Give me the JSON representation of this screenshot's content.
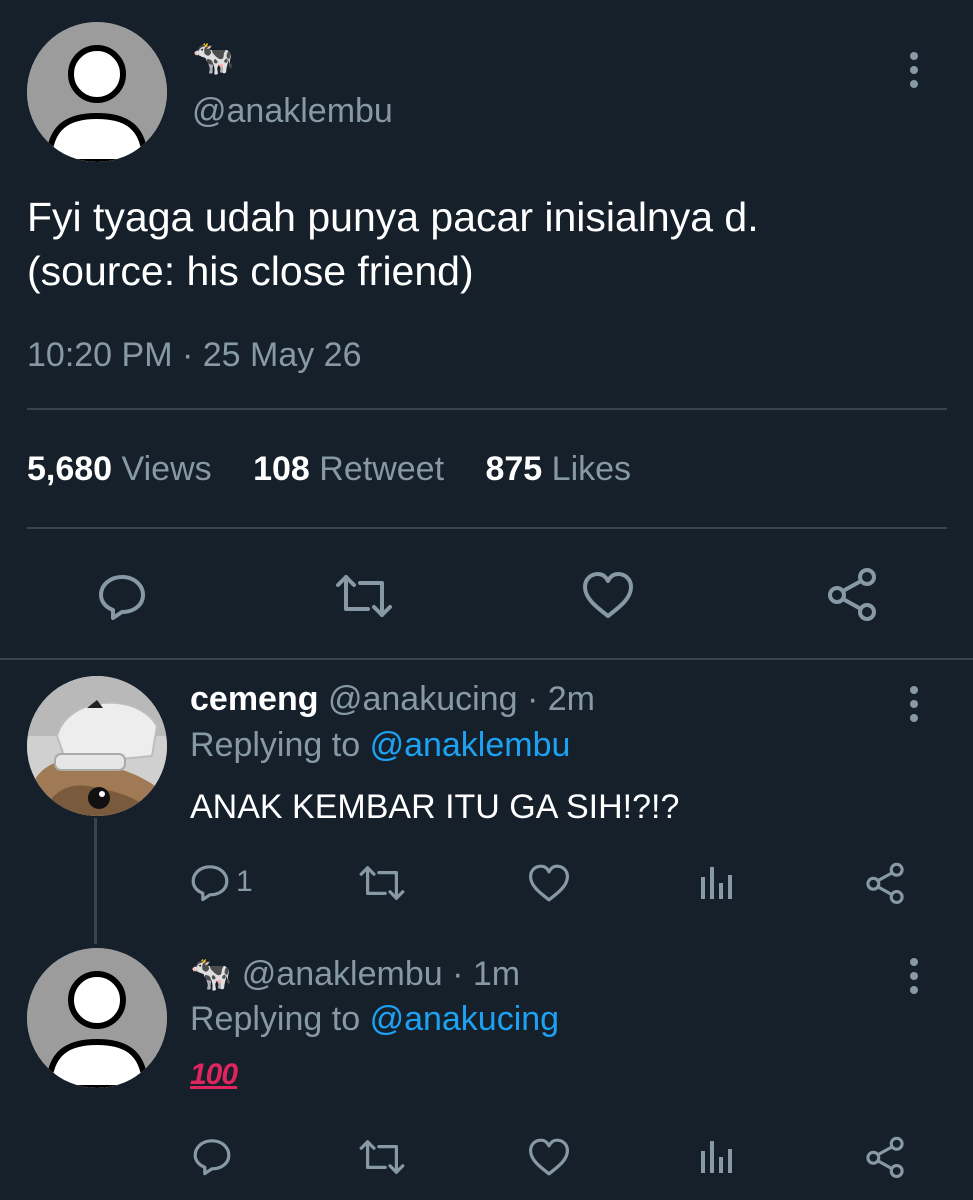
{
  "main_tweet": {
    "user_emoji": "🐄",
    "handle": "@anaklembu",
    "text_line1": "Fyi tyaga udah punya pacar inisialnya d.",
    "text_line2": "(source: his close friend)",
    "timestamp": "10:20 PM · 25 May 26",
    "stats": {
      "views_count": "5,680",
      "views_label": "Views",
      "retweet_count": "108",
      "retweet_label": "Retweet",
      "likes_count": "875",
      "likes_label": "Likes"
    },
    "actions": [
      "reply-icon",
      "retweet-icon",
      "like-icon",
      "share-icon"
    ]
  },
  "replies": [
    {
      "name": "cemeng",
      "handle": "@anakucing",
      "time": "· 2m",
      "replying_prefix": "Replying to",
      "replying_to": "@anaklembu",
      "text": "ANAK KEMBAR ITU GA SIH!?!?",
      "reply_count": "1"
    },
    {
      "user_emoji": "🐄",
      "handle": "@anaklembu",
      "time": "· 1m",
      "replying_prefix": "Replying to",
      "replying_to": "@anakucing",
      "text": "100"
    }
  ],
  "colors": {
    "background": "#15202b",
    "muted": "#8899a6",
    "link": "#1da1f2",
    "divider": "#38444d",
    "hundred": "#e0245e"
  }
}
